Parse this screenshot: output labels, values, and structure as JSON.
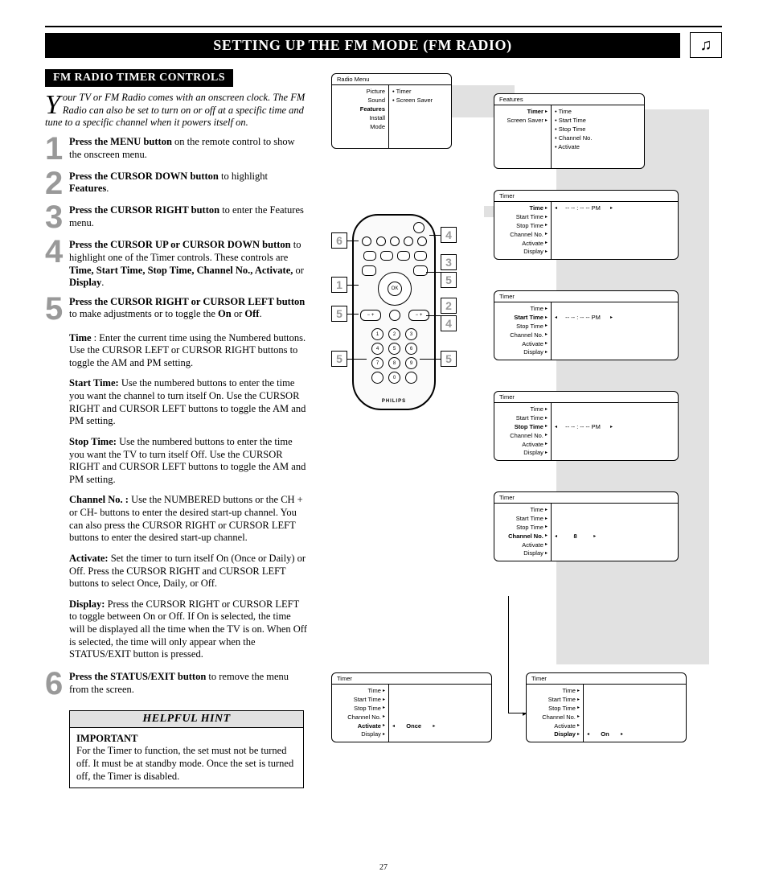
{
  "header": {
    "title": "SETTING UP THE FM MODE (FM RADIO)",
    "icon": "music-note"
  },
  "left": {
    "subhead": "FM RADIO TIMER CONTROLS",
    "intro_dropcap": "Y",
    "intro": "our TV or FM Radio comes with an onscreen clock. The FM Radio can also be set to turn on or off at a specific time and tune to a specific channel when it powers itself on.",
    "steps": [
      {
        "num": "1",
        "b1": "Press the MENU button",
        "rest": " on the remote control to show the onscreen menu."
      },
      {
        "num": "2",
        "b1": "Press the CURSOR DOWN  button",
        "rest": " to highlight ",
        "b2": "Features",
        "rest2": "."
      },
      {
        "num": "3",
        "b1": "Press the CURSOR RIGHT button",
        "rest": " to enter the Features menu."
      },
      {
        "num": "4",
        "b1": "Press the CURSOR UP or CURSOR DOWN button",
        "rest": " to highlight one of the Timer controls. These controls are ",
        "b2": "Time, Start Time, Stop Time, Channel No.,  Activate,",
        "rest2": " or ",
        "b3": "Display",
        "rest3": "."
      },
      {
        "num": "5",
        "b1": "Press the CURSOR RIGHT or CURSOR LEFT button",
        "rest": " to make adjustments or to toggle the ",
        "b2": "On",
        "rest2": " or ",
        "b3": "Off",
        "rest3": "."
      }
    ],
    "subdescs": [
      {
        "b": "Time",
        "rest": " : Enter the current time using the Numbered buttons. Use the CURSOR LEFT or CURSOR RIGHT buttons to toggle the AM and PM setting."
      },
      {
        "b": "Start Time:",
        "rest": " Use the numbered buttons to enter the time you want the channel to turn itself On. Use the CURSOR RIGHT and CURSOR LEFT buttons to toggle the AM and PM setting."
      },
      {
        "b": "Stop Time:",
        "rest": " Use the numbered buttons to enter the time you want the TV to turn itself Off. Use the CURSOR RIGHT and CURSOR LEFT buttons to toggle the AM and PM setting."
      },
      {
        "b": "Channel No. :",
        "rest": " Use the NUMBERED buttons or the CH + or CH- buttons to enter the desired start-up channel.  You can also press the CURSOR RIGHT or CURSOR LEFT buttons to enter the desired start-up channel."
      },
      {
        "b": "Activate:",
        "rest": " Set the timer to turn itself On (Once or Daily) or Off. Press the CURSOR RIGHT and CURSOR LEFT buttons to select Once, Daily, or Off."
      },
      {
        "b": "Display:",
        "rest": " Press the CURSOR RIGHT or CURSOR LEFT to toggle between On or Off. If On is selected, the time will be displayed all the time when the TV is on. When Off is selected, the time will only appear when the STATUS/EXIT button is pressed."
      }
    ],
    "step6": {
      "num": "6",
      "b1": "Press the STATUS/EXIT button",
      "rest": " to remove the menu from the screen."
    },
    "hint": {
      "title": "HELPFUL HINT",
      "important": "IMPORTANT",
      "body": "For the Timer to function, the set must not be turned off. It must be at standby mode. Once the set is turned off, the Timer is disabled."
    }
  },
  "diagram": {
    "menu1": {
      "title": "Radio Menu",
      "left": [
        "Picture",
        "Sound",
        "Features",
        "Install",
        "Mode"
      ],
      "right": [
        "Timer",
        "Screen Saver"
      ]
    },
    "menu_features": {
      "title": "Features",
      "left": [
        "Timer",
        "Screen Saver"
      ],
      "right": [
        "Time",
        "Start Time",
        "Stop Time",
        "Channel No.",
        "Activate"
      ]
    },
    "timer_rows": [
      "Time",
      "Start Time",
      "Stop Time",
      "Channel No.",
      "Activate",
      "Display"
    ],
    "timer_title": "Timer",
    "value_time": "-- -- : -- -- PM",
    "value_channel": "8",
    "value_activate": "Once",
    "value_display": "On",
    "callouts_left": [
      "6",
      "1",
      "5",
      "5"
    ],
    "callouts_right": [
      "4",
      "3",
      "5",
      "2",
      "4",
      "5"
    ],
    "remote_brand": "PHILIPS",
    "remote_numbers": [
      "1",
      "2",
      "3",
      "4",
      "5",
      "6",
      "7",
      "8",
      "9",
      "0"
    ]
  },
  "footer": {
    "page": "27"
  }
}
